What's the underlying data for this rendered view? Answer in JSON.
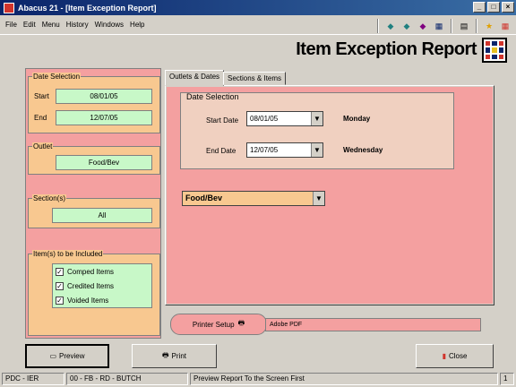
{
  "window": {
    "title": "Abacus 21 - [Item Exception Report]"
  },
  "menu": {
    "items": [
      "File",
      "Edit",
      "Menu",
      "History",
      "Windows",
      "Help"
    ]
  },
  "report_title": "Item Exception Report",
  "left": {
    "date_selection": {
      "legend": "Date Selection",
      "start_label": "Start",
      "start_value": "08/01/05",
      "end_label": "End",
      "end_value": "12/07/05"
    },
    "outlet": {
      "legend": "Outlet",
      "value": "Food/Bev"
    },
    "sections": {
      "legend": "Section(s)",
      "value": "All"
    },
    "items": {
      "legend": "Item(s) to be Included",
      "options": [
        "Comped Items",
        "Credited Items",
        "Voided Items"
      ]
    }
  },
  "tabs": [
    "Outlets & Dates",
    "Sections & Items"
  ],
  "main": {
    "date_legend": "Date Selection",
    "start_label": "Start Date",
    "start_value": "08/01/05",
    "start_day": "Monday",
    "end_label": "End Date",
    "end_value": "12/07/05",
    "end_day": "Wednesday",
    "outlet_value": "Food/Bev"
  },
  "printer": {
    "button_label": "Printer Setup",
    "printer_name": "Adobe PDF"
  },
  "buttons": {
    "preview": "Preview",
    "print": "Print",
    "close": "Close"
  },
  "status": {
    "left": "PDC - IER",
    "middle": "00 - FB - RD - BUTCH",
    "message": "Preview Report To the Screen First",
    "page": "1"
  },
  "colors": {
    "pink": "#f4a0a0",
    "orange": "#f8c890",
    "green": "#c8f8c8"
  }
}
